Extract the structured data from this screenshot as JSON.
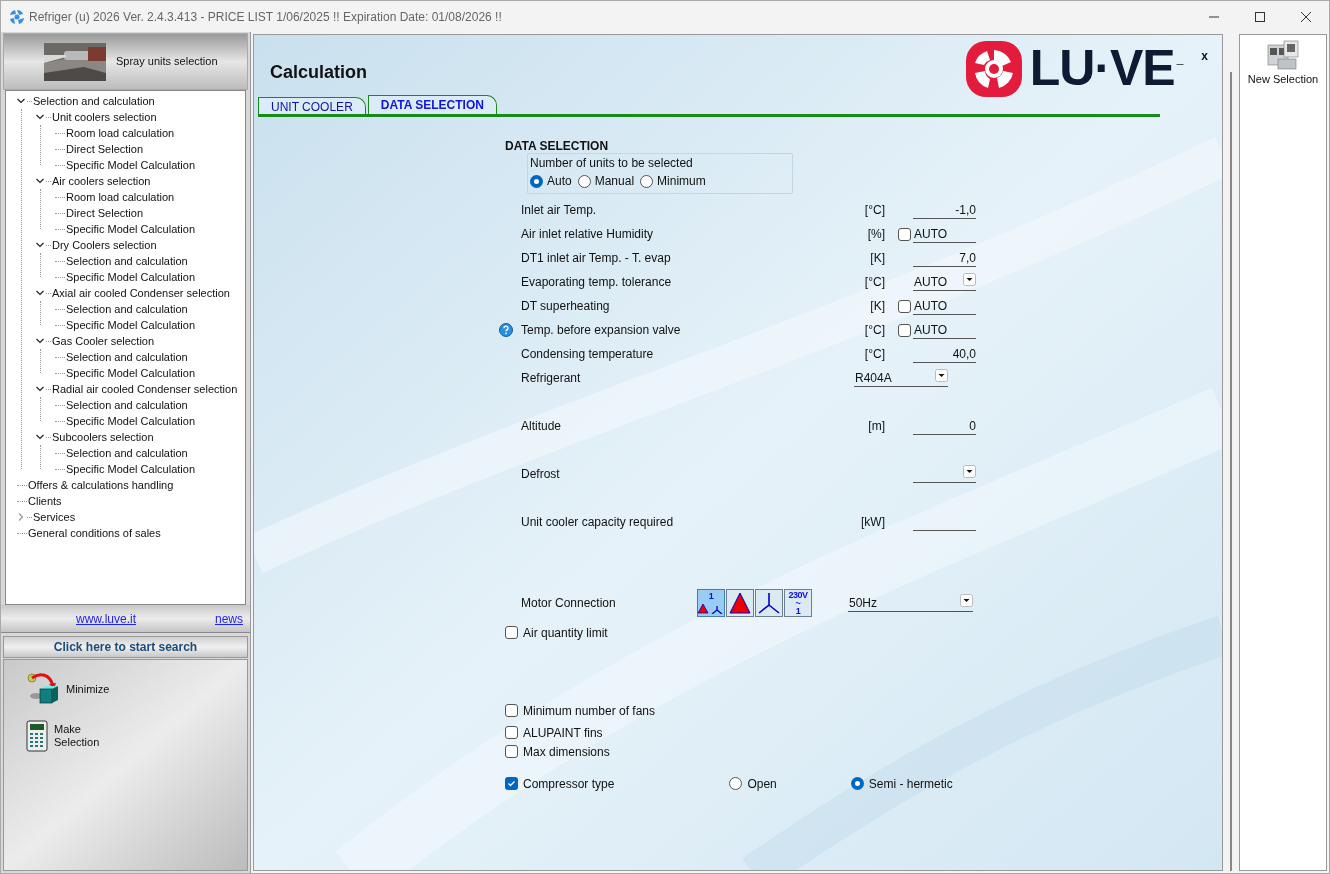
{
  "window": {
    "title": "Refriger (u) 2026 Ver. 2.4.3.413 - PRICE LIST 1/06/2025 !! Expiration Date: 01/08/2026 !!"
  },
  "sidebar": {
    "header": "Spray units selection",
    "tree": [
      {
        "label": "Selection and calculation",
        "expanded": true,
        "children": [
          {
            "label": "Unit coolers selection",
            "expanded": true,
            "children": [
              {
                "label": "Room load calculation"
              },
              {
                "label": "Direct Selection"
              },
              {
                "label": "Specific Model Calculation"
              }
            ]
          },
          {
            "label": "Air coolers selection",
            "expanded": true,
            "children": [
              {
                "label": "Room load calculation"
              },
              {
                "label": "Direct Selection"
              },
              {
                "label": "Specific Model Calculation"
              }
            ]
          },
          {
            "label": "Dry Coolers selection",
            "expanded": true,
            "children": [
              {
                "label": "Selection and calculation"
              },
              {
                "label": "Specific Model Calculation"
              }
            ]
          },
          {
            "label": "Axial air cooled Condenser selection",
            "expanded": true,
            "children": [
              {
                "label": "Selection and calculation"
              },
              {
                "label": "Specific Model Calculation"
              }
            ]
          },
          {
            "label": "Gas Cooler selection",
            "expanded": true,
            "children": [
              {
                "label": "Selection and calculation"
              },
              {
                "label": "Specific Model Calculation"
              }
            ]
          },
          {
            "label": "Radial  air cooled Condenser selection",
            "expanded": true,
            "children": [
              {
                "label": "Selection and calculation"
              },
              {
                "label": "Specific Model Calculation"
              }
            ]
          },
          {
            "label": "Subcoolers selection",
            "expanded": true,
            "children": [
              {
                "label": "Selection and calculation"
              },
              {
                "label": "Specific Model Calculation"
              }
            ]
          }
        ]
      },
      {
        "label": "Offers & calculations handling"
      },
      {
        "label": "Clients"
      },
      {
        "label": "Services",
        "expanded": false
      },
      {
        "label": "General conditions of sales"
      }
    ],
    "links": [
      "www.luve.it",
      "news"
    ],
    "search_button": "Click here to start search",
    "actions": [
      {
        "kind": "minimize",
        "label": "Minimize"
      },
      {
        "kind": "calculator",
        "label": "Make Selection"
      }
    ]
  },
  "main": {
    "title": "Calculation",
    "logo": "LU·VE",
    "panel_buttons": [
      "_",
      "x"
    ],
    "tabs": [
      {
        "label": "UNIT COOLER",
        "selected": false
      },
      {
        "label": "DATA SELECTION",
        "selected": true
      }
    ],
    "section_title": "DATA SELECTION",
    "units_group": {
      "label": "Number of units to be selected",
      "options": [
        {
          "label": "Auto",
          "selected": true
        },
        {
          "label": "Manual",
          "selected": false
        },
        {
          "label": "Minimum",
          "selected": false
        }
      ]
    },
    "fields": [
      {
        "kind": "number",
        "label": "Inlet air Temp.",
        "unit": "[°C]",
        "value": "-1,0"
      },
      {
        "kind": "auto_check",
        "label": "Air inlet relative Humidity",
        "unit": "[%]",
        "checked": false,
        "value": "AUTO"
      },
      {
        "kind": "number",
        "label": "DT1 inlet air Temp. -  T. evap",
        "unit": "[K]",
        "value": "7,0"
      },
      {
        "kind": "dropdown",
        "label": "Evaporating temp. tolerance",
        "unit": "[°C]",
        "value": "AUTO"
      },
      {
        "kind": "auto_check",
        "label": "DT superheating",
        "unit": "[K]",
        "checked": false,
        "value": "AUTO"
      },
      {
        "kind": "auto_check",
        "label": "Temp. before expansion valve",
        "unit": "[°C]",
        "checked": false,
        "value": "AUTO",
        "help": true
      },
      {
        "kind": "number",
        "label": "Condensing temperature",
        "unit": "[°C]",
        "value": "40,0"
      },
      {
        "kind": "wide_dropdown",
        "label": "Refrigerant",
        "value": "R404A"
      }
    ],
    "extra_fields": [
      {
        "kind": "number",
        "label": "Altitude",
        "unit": "[m]",
        "value": "0"
      },
      {
        "kind": "dropdown",
        "label": "Defrost"
      },
      {
        "kind": "number",
        "label": "Unit cooler capacity required",
        "unit": "[kW]"
      }
    ],
    "motor": {
      "label": "Motor Connection",
      "buttons": [
        {
          "kind": "star_delta",
          "lines": [
            "1"
          ],
          "selected": true
        },
        {
          "kind": "delta",
          "selected": false
        },
        {
          "kind": "star",
          "selected": false
        },
        {
          "kind": "single_phase",
          "lines": [
            "230V",
            "~",
            "1"
          ],
          "selected": false
        }
      ],
      "frequency": "50Hz"
    },
    "air_quantity_limit": {
      "label": "Air quantity limit",
      "checked": false
    },
    "options": [
      {
        "label": "Minimum number of fans",
        "checked": false
      },
      {
        "label": "ALUPAINT fins",
        "checked": false
      },
      {
        "label": "Max dimensions",
        "checked": false
      }
    ],
    "compressor": {
      "label": "Compressor type",
      "checked": true,
      "choices": [
        {
          "label": "Open",
          "selected": false
        },
        {
          "label": "Semi - hermetic",
          "selected": true
        }
      ]
    }
  },
  "right_panel": {
    "button": "New Selection"
  }
}
